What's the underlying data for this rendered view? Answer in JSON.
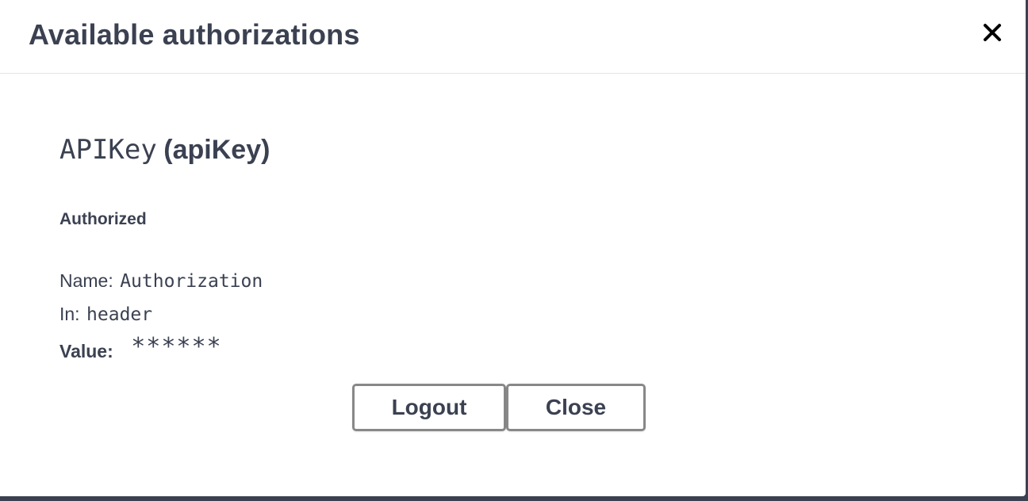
{
  "modal": {
    "title": "Available authorizations",
    "close_icon": "close-icon"
  },
  "auth": {
    "name": "APIKey",
    "type": "(apiKey)",
    "status": "Authorized",
    "name_label": "Name:",
    "name_value": "Authorization",
    "in_label": "In:",
    "in_value": "header",
    "value_label": "Value:",
    "value_masked": "******"
  },
  "buttons": {
    "logout_label": "Logout",
    "close_label": "Close"
  },
  "colors": {
    "text": "#3b4151",
    "backdrop": "#3b4151",
    "border": "#888888",
    "divider": "#e6e6e6"
  }
}
